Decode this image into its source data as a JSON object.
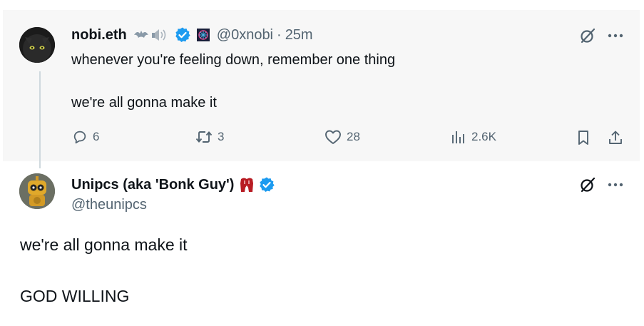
{
  "parent": {
    "display_name": "nobi.eth",
    "handle": "@0xnobi",
    "separator": "·",
    "time": "25m",
    "text_line1": "whenever you're feeling down, remember one thing",
    "text_line2": "we're all gonna make it",
    "actions": {
      "replies": "6",
      "reposts": "3",
      "likes": "28",
      "views": "2.6K"
    }
  },
  "reply": {
    "display_name": "Unipcs (aka 'Bonk Guy')",
    "handle": "@theunipcs",
    "text_line1": "we're all gonna make it",
    "text_line2": "GOD WILLING"
  },
  "colors": {
    "verified": "#1d9bf0",
    "text": "#0f1419",
    "secondary": "#536471",
    "parent_background": "#f7f7f7"
  },
  "icons": [
    "verified-badge-icon",
    "grok-icon",
    "more-icon",
    "reply-icon",
    "repost-icon",
    "like-icon",
    "views-icon",
    "bookmark-icon",
    "share-icon"
  ]
}
